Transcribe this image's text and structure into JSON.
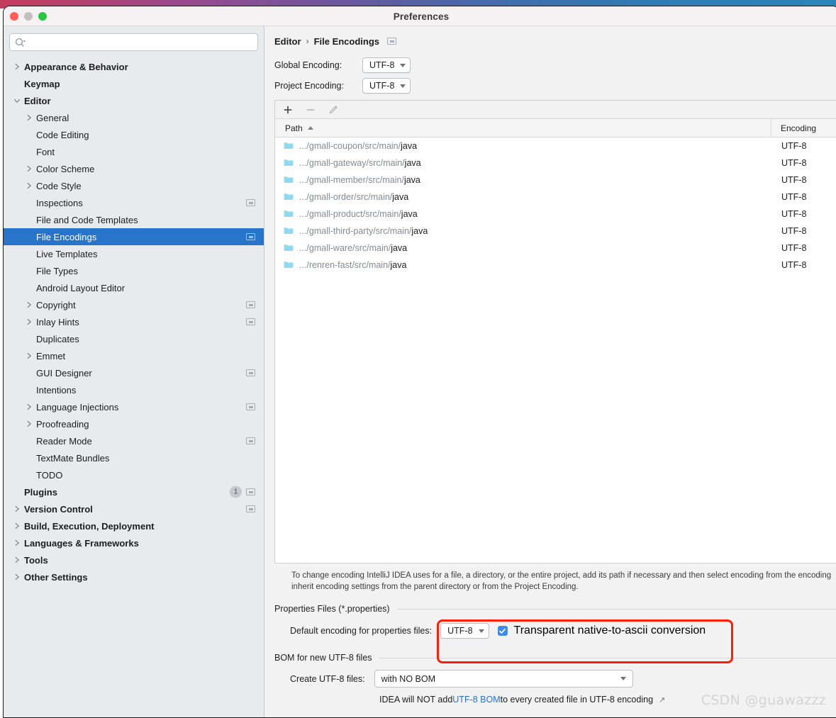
{
  "window": {
    "title": "Preferences",
    "traffic_lights": [
      "close",
      "minimize",
      "zoom"
    ]
  },
  "sidebar": {
    "search": {
      "value": "",
      "placeholder": ""
    },
    "items": [
      {
        "label": "Appearance & Behavior",
        "level": 0,
        "bold": true,
        "arrow": "right",
        "badge": null,
        "proj_icon": false,
        "selected": false
      },
      {
        "label": "Keymap",
        "level": 0,
        "bold": true,
        "arrow": "none",
        "badge": null,
        "proj_icon": false,
        "selected": false
      },
      {
        "label": "Editor",
        "level": 0,
        "bold": true,
        "arrow": "down",
        "badge": null,
        "proj_icon": false,
        "selected": false
      },
      {
        "label": "General",
        "level": 1,
        "bold": false,
        "arrow": "right",
        "badge": null,
        "proj_icon": false,
        "selected": false
      },
      {
        "label": "Code Editing",
        "level": 1,
        "bold": false,
        "arrow": "none",
        "badge": null,
        "proj_icon": false,
        "selected": false
      },
      {
        "label": "Font",
        "level": 1,
        "bold": false,
        "arrow": "none",
        "badge": null,
        "proj_icon": false,
        "selected": false
      },
      {
        "label": "Color Scheme",
        "level": 1,
        "bold": false,
        "arrow": "right",
        "badge": null,
        "proj_icon": false,
        "selected": false
      },
      {
        "label": "Code Style",
        "level": 1,
        "bold": false,
        "arrow": "right",
        "badge": null,
        "proj_icon": false,
        "selected": false
      },
      {
        "label": "Inspections",
        "level": 1,
        "bold": false,
        "arrow": "none",
        "badge": null,
        "proj_icon": true,
        "selected": false
      },
      {
        "label": "File and Code Templates",
        "level": 1,
        "bold": false,
        "arrow": "none",
        "badge": null,
        "proj_icon": false,
        "selected": false
      },
      {
        "label": "File Encodings",
        "level": 1,
        "bold": false,
        "arrow": "none",
        "badge": null,
        "proj_icon": true,
        "selected": true
      },
      {
        "label": "Live Templates",
        "level": 1,
        "bold": false,
        "arrow": "none",
        "badge": null,
        "proj_icon": false,
        "selected": false
      },
      {
        "label": "File Types",
        "level": 1,
        "bold": false,
        "arrow": "none",
        "badge": null,
        "proj_icon": false,
        "selected": false
      },
      {
        "label": "Android Layout Editor",
        "level": 1,
        "bold": false,
        "arrow": "none",
        "badge": null,
        "proj_icon": false,
        "selected": false
      },
      {
        "label": "Copyright",
        "level": 1,
        "bold": false,
        "arrow": "right",
        "badge": null,
        "proj_icon": true,
        "selected": false
      },
      {
        "label": "Inlay Hints",
        "level": 1,
        "bold": false,
        "arrow": "right",
        "badge": null,
        "proj_icon": true,
        "selected": false
      },
      {
        "label": "Duplicates",
        "level": 1,
        "bold": false,
        "arrow": "none",
        "badge": null,
        "proj_icon": false,
        "selected": false
      },
      {
        "label": "Emmet",
        "level": 1,
        "bold": false,
        "arrow": "right",
        "badge": null,
        "proj_icon": false,
        "selected": false
      },
      {
        "label": "GUI Designer",
        "level": 1,
        "bold": false,
        "arrow": "none",
        "badge": null,
        "proj_icon": true,
        "selected": false
      },
      {
        "label": "Intentions",
        "level": 1,
        "bold": false,
        "arrow": "none",
        "badge": null,
        "proj_icon": false,
        "selected": false
      },
      {
        "label": "Language Injections",
        "level": 1,
        "bold": false,
        "arrow": "right",
        "badge": null,
        "proj_icon": true,
        "selected": false
      },
      {
        "label": "Proofreading",
        "level": 1,
        "bold": false,
        "arrow": "right",
        "badge": null,
        "proj_icon": false,
        "selected": false
      },
      {
        "label": "Reader Mode",
        "level": 1,
        "bold": false,
        "arrow": "none",
        "badge": null,
        "proj_icon": true,
        "selected": false
      },
      {
        "label": "TextMate Bundles",
        "level": 1,
        "bold": false,
        "arrow": "none",
        "badge": null,
        "proj_icon": false,
        "selected": false
      },
      {
        "label": "TODO",
        "level": 1,
        "bold": false,
        "arrow": "none",
        "badge": null,
        "proj_icon": false,
        "selected": false
      },
      {
        "label": "Plugins",
        "level": 0,
        "bold": true,
        "arrow": "none",
        "badge": "1",
        "proj_icon": true,
        "selected": false
      },
      {
        "label": "Version Control",
        "level": 0,
        "bold": true,
        "arrow": "right",
        "badge": null,
        "proj_icon": true,
        "selected": false
      },
      {
        "label": "Build, Execution, Deployment",
        "level": 0,
        "bold": true,
        "arrow": "right",
        "badge": null,
        "proj_icon": false,
        "selected": false
      },
      {
        "label": "Languages & Frameworks",
        "level": 0,
        "bold": true,
        "arrow": "right",
        "badge": null,
        "proj_icon": false,
        "selected": false
      },
      {
        "label": "Tools",
        "level": 0,
        "bold": true,
        "arrow": "right",
        "badge": null,
        "proj_icon": false,
        "selected": false
      },
      {
        "label": "Other Settings",
        "level": 0,
        "bold": true,
        "arrow": "right",
        "badge": null,
        "proj_icon": false,
        "selected": false
      }
    ]
  },
  "main": {
    "breadcrumb": {
      "parent": "Editor",
      "separator": "›",
      "current": "File Encodings"
    },
    "global_encoding": {
      "label": "Global Encoding:",
      "value": "UTF-8"
    },
    "project_encoding": {
      "label": "Project Encoding:",
      "value": "UTF-8"
    },
    "toolbar": {
      "add": "+",
      "remove": "−",
      "edit": "edit-pencil"
    },
    "table": {
      "columns": [
        "Path",
        "Encoding"
      ],
      "sort_column": "Path",
      "sort_direction": "ascending",
      "rows": [
        {
          "path_dim": ".../gmall-coupon/src/main/",
          "path_strong": "java",
          "encoding": "UTF-8"
        },
        {
          "path_dim": ".../gmall-gateway/src/main/",
          "path_strong": "java",
          "encoding": "UTF-8"
        },
        {
          "path_dim": ".../gmall-member/src/main/",
          "path_strong": "java",
          "encoding": "UTF-8"
        },
        {
          "path_dim": ".../gmall-order/src/main/",
          "path_strong": "java",
          "encoding": "UTF-8"
        },
        {
          "path_dim": ".../gmall-product/src/main/",
          "path_strong": "java",
          "encoding": "UTF-8"
        },
        {
          "path_dim": ".../gmall-third-party/src/main/",
          "path_strong": "java",
          "encoding": "UTF-8"
        },
        {
          "path_dim": ".../gmall-ware/src/main/",
          "path_strong": "java",
          "encoding": "UTF-8"
        },
        {
          "path_dim": ".../renren-fast/src/main/",
          "path_strong": "java",
          "encoding": "UTF-8"
        }
      ]
    },
    "help_line_1": "To change encoding IntelliJ IDEA uses for a file, a directory, or the entire project, add its path if necessary and then select encoding from the encoding",
    "help_line_2": "inherit encoding settings from the parent directory or from the Project Encoding.",
    "properties_section": {
      "title": "Properties Files (*.properties)",
      "default_encoding_label": "Default encoding for properties files:",
      "default_encoding_value": "UTF-8",
      "checkbox_label": "Transparent native-to-ascii conversion",
      "checkbox_checked": true
    },
    "bom_section": {
      "title": "BOM for new UTF-8 files",
      "create_label": "Create UTF-8 files:",
      "create_value": "with NO BOM",
      "note_prefix": "IDEA will NOT add ",
      "note_link": "UTF-8 BOM",
      "note_suffix": " to every created file in UTF-8 encoding"
    }
  },
  "watermark": "CSDN @guawazzz",
  "colors": {
    "selection_blue": "#2675cb",
    "highlight_red": "#fb1f07",
    "link_blue": "#2b70c4",
    "checkbox_blue": "#3c8ce8",
    "folder_cyan": "#8fd8ee",
    "sidebar_bg": "#e7ebee",
    "main_bg": "#f2f2f2"
  }
}
